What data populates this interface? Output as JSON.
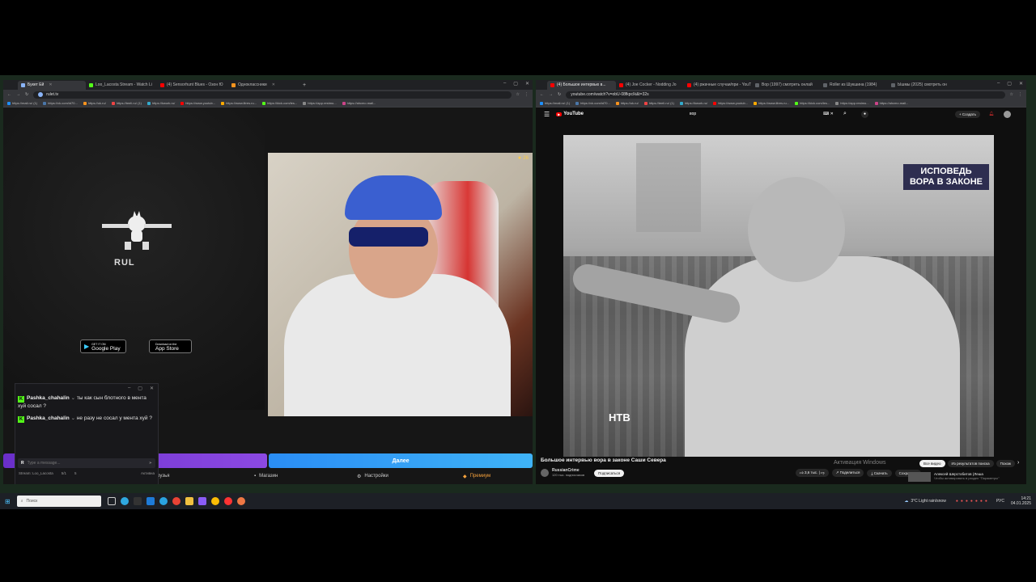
{
  "left_browser": {
    "tabs": [
      {
        "label": "Букет Ей",
        "active": true,
        "color": "#8ab4f8"
      },
      {
        "label": "Loo_Lacosta Stream - Watch Li",
        "color": "#53fc18"
      },
      {
        "label": "(4) Sensorhunt Blues - Озон Ю",
        "color": "#ff0000"
      },
      {
        "label": "Одноклассники",
        "color": "#f7931e"
      }
    ],
    "new_tab": "+",
    "url": "rulet.tv",
    "bookmarks": [
      "https://mail.ru/ (1)",
      "https://vk.com/id70...",
      "https://ok.ru/",
      "https://teeli.ru/ (1)",
      "https://kwork.ru/",
      "https://www.youtub...",
      "https://www.litres.ru...",
      "https://kick.com/les...",
      "https://app.restmo...",
      "https://ahcmo.mail..."
    ]
  },
  "rulet": {
    "logo_text": "RUL",
    "google_play": {
      "small": "GET IT ON",
      "big": "Google Play"
    },
    "app_store": {
      "small": "Download on the",
      "big": "App Store"
    },
    "cam_badge": "★ 26",
    "next_button": "Далее",
    "nav": {
      "friends": "Друзья",
      "shop": "Магазин",
      "settings": "Настройки",
      "premium": "Премиум"
    }
  },
  "chat": {
    "messages": [
      {
        "user": "Pashka_chahalin",
        "text": "ты как сын блотного в мента хуй сосал ?"
      },
      {
        "user": "Pashka_chahalin",
        "text": "не разу не сосал у мента хуй ?"
      }
    ],
    "input_placeholder": "Type a message...",
    "footer": {
      "stream": "Stream: Loo_Lacosta",
      "count1": "5/1",
      "count2": "5",
      "status": "Активна"
    }
  },
  "right_browser": {
    "tabs": [
      {
        "label": "(4) Большое интервью в...",
        "active": true,
        "color": "#ff0000"
      },
      {
        "label": "(4) Joe Cocker - Nodding Jo",
        "color": "#ff0000"
      },
      {
        "label": "(4) ржачные случаи/при - YouT",
        "color": "#ff0000"
      },
      {
        "label": "Вор (1997) смотреть онлай",
        "color": "#5f6368"
      },
      {
        "label": "Roller из Шукшина (1984)",
        "color": "#5f6368"
      },
      {
        "label": "Ышмы (2025) смотреть он",
        "color": "#5f6368"
      }
    ],
    "url": "youtube.com/watch?v=obU-08fkpcIk&t=32s",
    "bookmarks": [
      "https://mail.ru/ (1)",
      "https://vk.com/id70...",
      "https://ok.ru/",
      "https://teeli.ru/ (1)",
      "https://kwork.ru/",
      "https://www.youtub...",
      "https://www.litres.ru...",
      "https://kick.com/les...",
      "https://app.restmo...",
      "https://ahcmo.mail..."
    ]
  },
  "youtube": {
    "logo": "YouTube",
    "search_value": "вор",
    "create_label": "Создать",
    "overlay_title_line1": "ИСПОВЕДЬ",
    "overlay_title_line2": "ВОРА В ЗАКОНЕ",
    "channel_logo": "НТВ",
    "video_title": "Большое интервью вора в законе Саши Севера",
    "channel": "RussianCrime",
    "subscribers": "120 тыс. подписчиков",
    "subscribe": "Подписаться",
    "likes": "3,6 тыс.",
    "share": "Поделиться",
    "download": "Скачать",
    "save": "Сохранить",
    "chips": [
      "Все видео",
      "Из результатов поиска",
      "Похож"
    ],
    "windows_activation": "Активация Windows",
    "rec_title": "Алексей Шерстобитов (Леша",
    "rec_sub": "Чтобы активировать в раздел \"Параметры\""
  },
  "taskbar": {
    "search_placeholder": "Поиск",
    "weather": "3°C  Light rain/snow",
    "lang": "РУС",
    "time": "14:21",
    "date": "04.01.2025"
  }
}
